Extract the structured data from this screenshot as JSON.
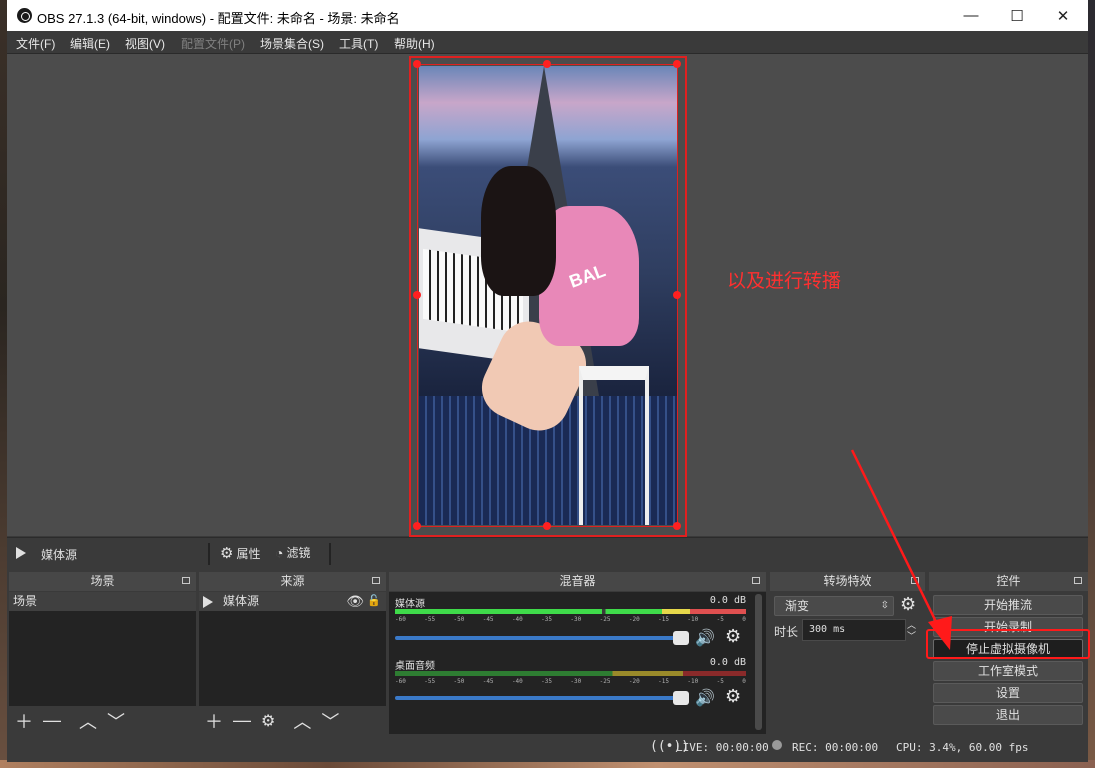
{
  "window": {
    "title": "OBS 27.1.3 (64-bit, windows) - 配置文件: 未命名 - 场景: 未命名",
    "minimize": "—",
    "maximize": "☐",
    "close": "✕"
  },
  "menu": {
    "items": [
      "文件(F)",
      "编辑(E)",
      "视图(V)",
      "配置文件(P)",
      "场景集合(S)",
      "工具(T)",
      "帮助(H)"
    ]
  },
  "preview": {
    "shirt_text": "BAL",
    "annotation": "以及进行转播"
  },
  "source_toolbar": {
    "source_name": "媒体源",
    "properties": "属性",
    "filters": "滤镜"
  },
  "docks": {
    "scenes": {
      "title": "场景",
      "items": [
        "场景"
      ]
    },
    "sources": {
      "title": "来源",
      "items": [
        "媒体源"
      ]
    },
    "mixer": {
      "title": "混音器",
      "channels": [
        {
          "name": "媒体源",
          "level": "0.0 dB"
        },
        {
          "name": "桌面音频",
          "level": "0.0 dB"
        }
      ],
      "ticks": [
        "-60",
        "-55",
        "-50",
        "-45",
        "-40",
        "-35",
        "-30",
        "-25",
        "-20",
        "-15",
        "-10",
        "-5",
        "0"
      ]
    },
    "transitions": {
      "title": "转场特效",
      "selected": "渐变",
      "duration_label": "时长",
      "duration_value": "300 ms"
    },
    "controls": {
      "title": "控件",
      "buttons": [
        "开始推流",
        "开始录制",
        "停止虚拟摄像机",
        "工作室模式",
        "设置",
        "退出"
      ]
    }
  },
  "status": {
    "live": "LIVE: 00:00:00",
    "rec": "REC: 00:00:00",
    "cpu": "CPU: 3.4%, 60.00 fps"
  },
  "colors": {
    "annotation": "#ff2020",
    "panel": "#3a3a3a",
    "list": "#232323"
  }
}
